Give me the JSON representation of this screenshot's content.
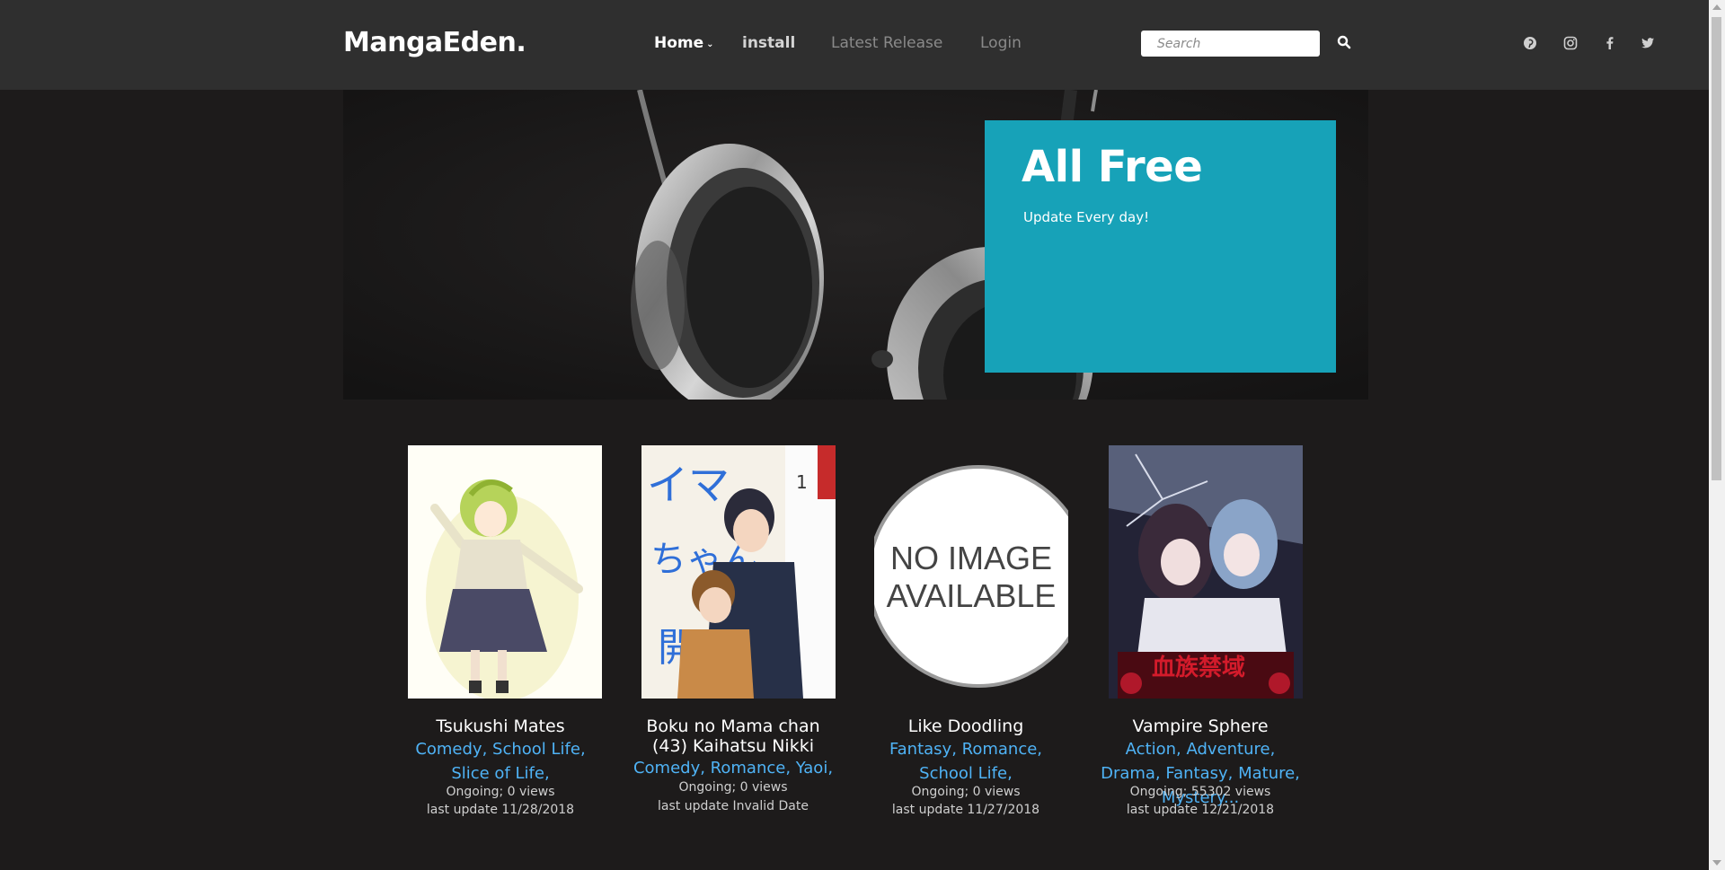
{
  "header": {
    "logo": "MangaEden.",
    "nav": {
      "home": "Home",
      "install": "install",
      "latest": "Latest Release",
      "login": "Login"
    },
    "search_placeholder": "Search",
    "social_icons": [
      "pinterest-icon",
      "instagram-icon",
      "facebook-icon",
      "twitter-icon"
    ]
  },
  "hero": {
    "title": "All Free",
    "subtitle": "Update Every day!",
    "card_color": "#17a2b8"
  },
  "manga": [
    {
      "title": "Tsukushi Mates",
      "genres": "Comedy, School Life, Slice of Life,",
      "status": "Ongoing; 0 views",
      "update": "last update 11/28/2018"
    },
    {
      "title": "Boku no Mama chan (43) Kaihatsu Nikki",
      "genres": "Comedy, Romance, Yaoi,",
      "status": "Ongoing; 0 views",
      "update": "last update Invalid Date"
    },
    {
      "title": "Like Doodling",
      "genres": "Fantasy, Romance, School Life,",
      "status": "Ongoing; 0 views",
      "update": "last update 11/27/2018",
      "no_image_line1": "NO IMAGE",
      "no_image_line2": "AVAILABLE"
    },
    {
      "title": "Vampire Sphere",
      "genres": "Action, Adventure, Drama, Fantasy, Mature, Mystery...",
      "status": "Ongoing; 55302 views",
      "update": "last update 12/21/2018"
    }
  ],
  "colors": {
    "topbar": "#2f2f2f",
    "background": "#1d1b1b",
    "genre_link": "#4fb3f6"
  }
}
